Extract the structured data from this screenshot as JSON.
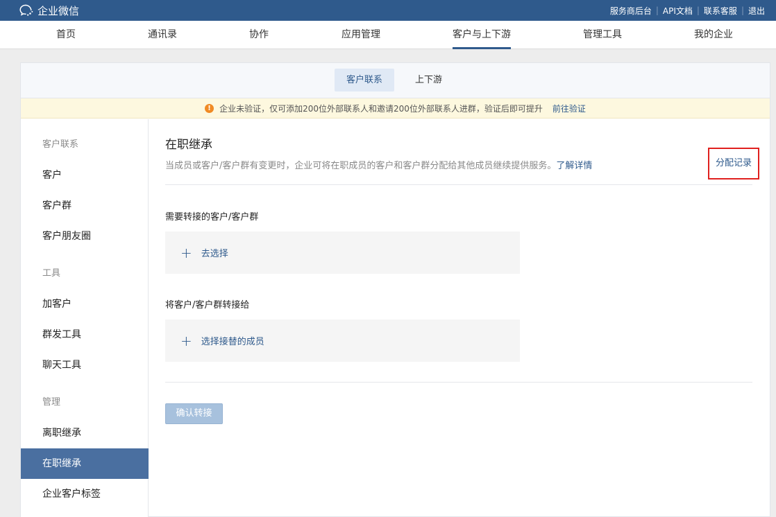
{
  "topbar": {
    "app_name": "企业微信",
    "links": [
      "服务商后台",
      "API文档",
      "联系客服",
      "退出"
    ]
  },
  "main_nav": {
    "items": [
      "首页",
      "通讯录",
      "协作",
      "应用管理",
      "客户与上下游",
      "管理工具",
      "我的企业"
    ],
    "active_index": 4
  },
  "sub_tabs": {
    "items": [
      "客户联系",
      "上下游"
    ],
    "active_index": 0
  },
  "notice": {
    "icon": "warning-icon",
    "text": "企业未验证，仅可添加200位外部联系人和邀请200位外部联系人进群，验证后即可提升",
    "link": "前往验证"
  },
  "sidebar": {
    "groups": [
      {
        "title": "客户联系",
        "items": [
          "客户",
          "客户群",
          "客户朋友圈"
        ]
      },
      {
        "title": "工具",
        "items": [
          "加客户",
          "群发工具",
          "聊天工具"
        ]
      },
      {
        "title": "管理",
        "items": [
          "离职继承",
          "在职继承",
          "企业客户标签"
        ]
      }
    ],
    "active_item": "在职继承"
  },
  "content": {
    "title": "在职继承",
    "description": "当成员或客户/客户群有变更时，企业可将在职成员的客户和客户群分配给其他成员继续提供服务。",
    "description_link": "了解详情",
    "record_link": "分配记录",
    "section1_label": "需要转接的客户/客户群",
    "section1_button": "去选择",
    "section2_label": "将客户/客户群转接给",
    "section2_button": "选择接替的成员",
    "confirm_button": "确认转接"
  },
  "colors": {
    "brand": "#2f5a8c",
    "sidebar_active": "#4a6fa0",
    "notice_bg": "#fdf8df",
    "warning": "#f08a24",
    "highlight_border": "#e0201e"
  }
}
